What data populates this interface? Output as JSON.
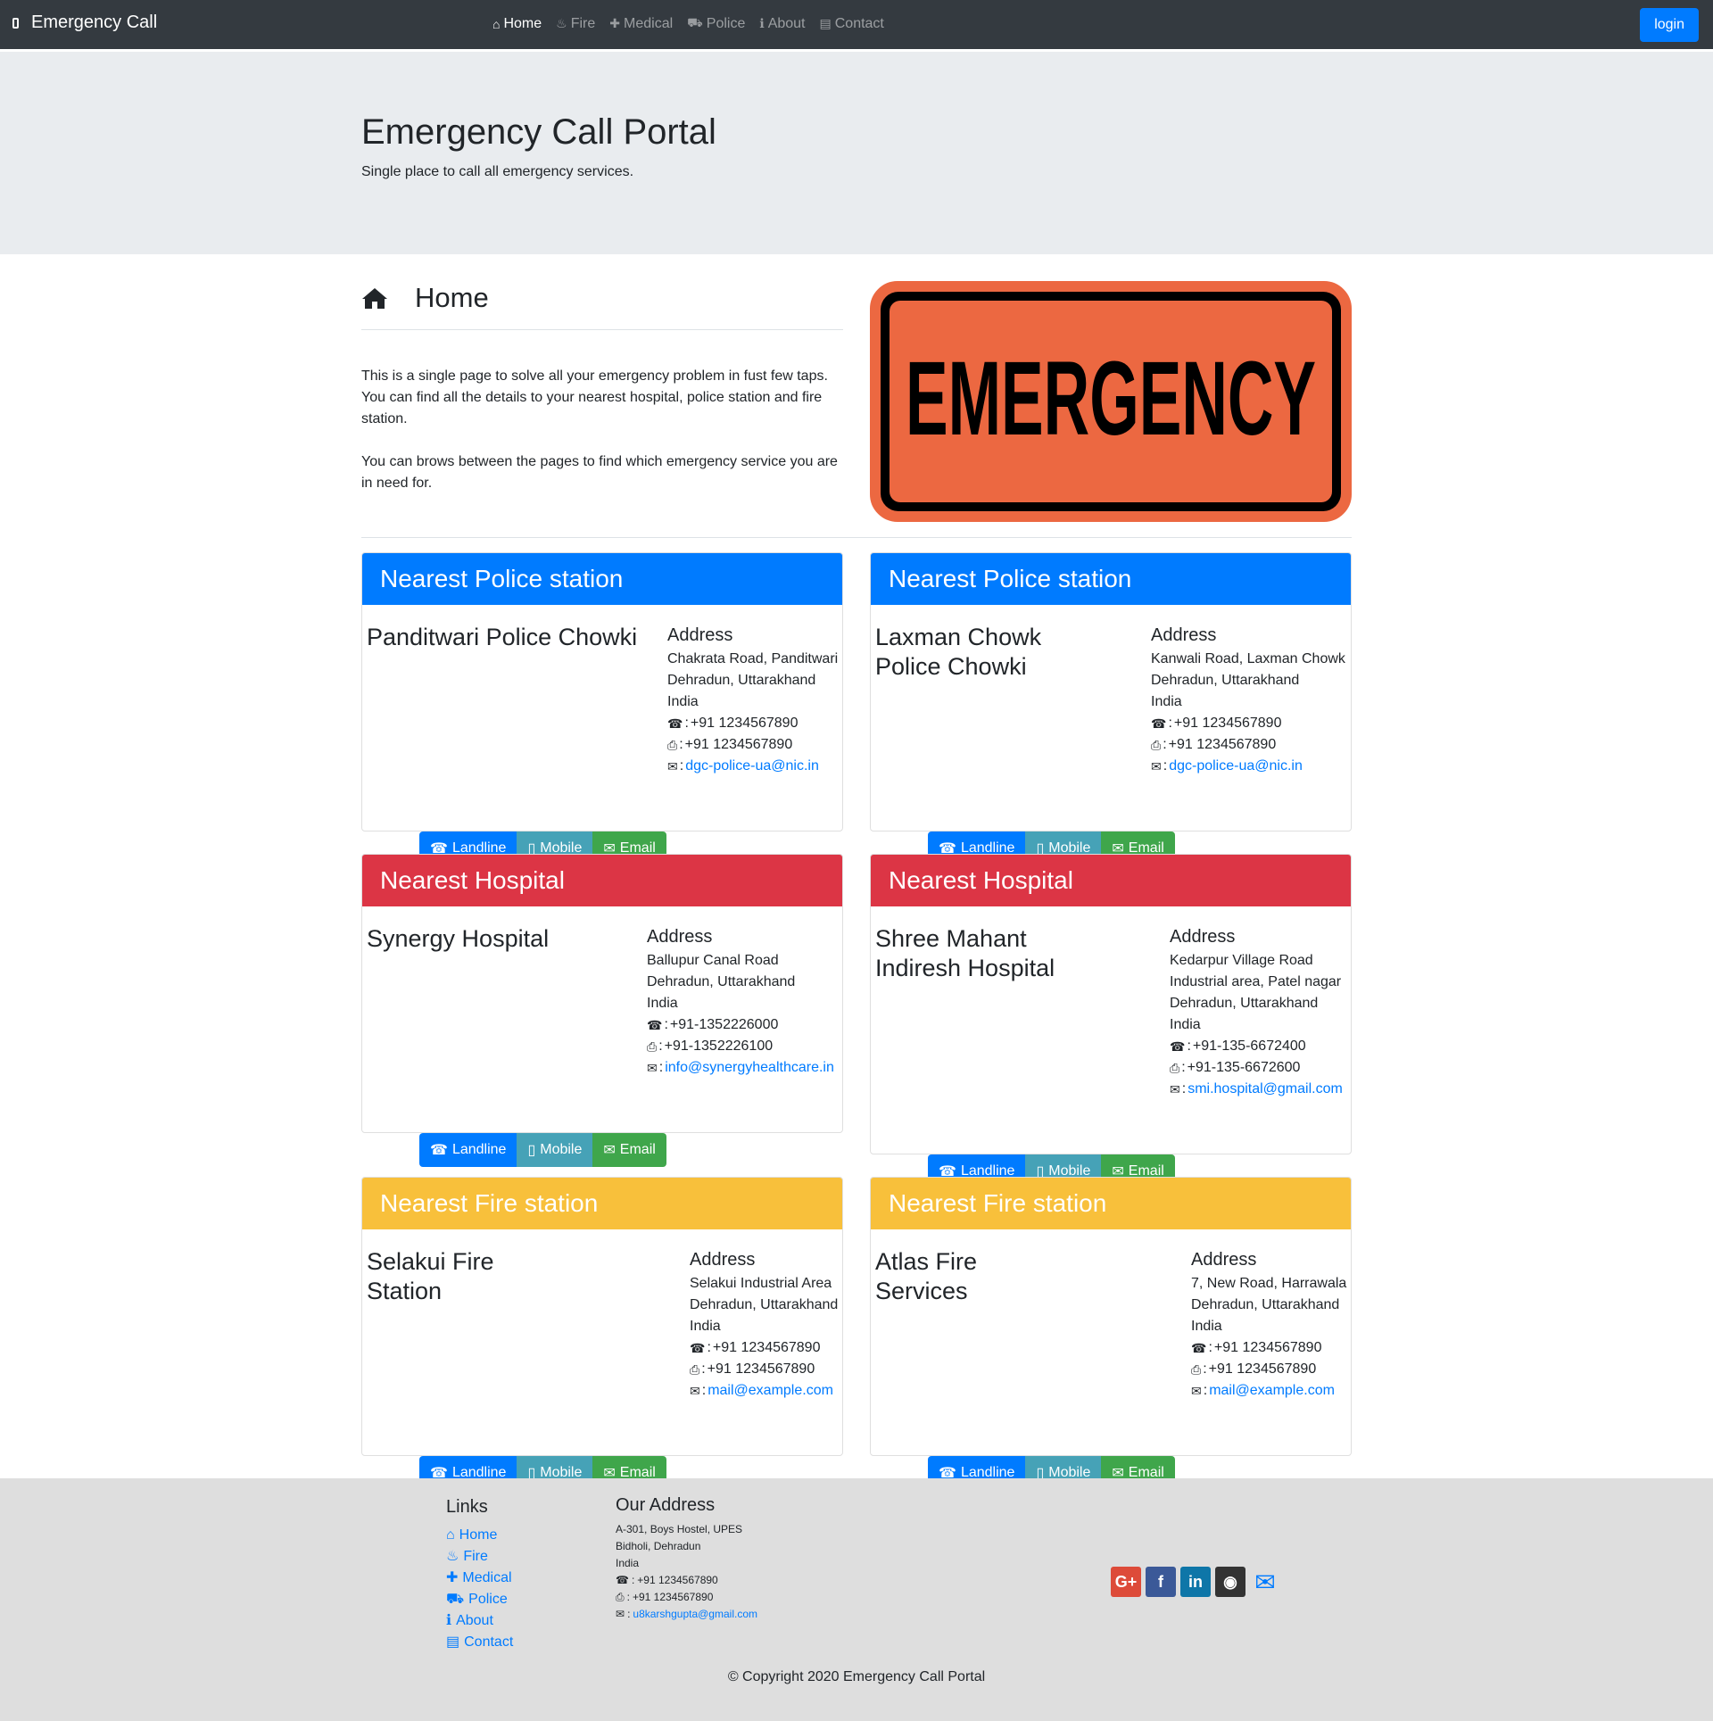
{
  "navbar": {
    "brand": "Emergency Call",
    "links": [
      {
        "icon": "home-icon",
        "label": "Home"
      },
      {
        "icon": "fire-icon",
        "label": "Fire"
      },
      {
        "icon": "ambulance-icon",
        "label": "Medical"
      },
      {
        "icon": "car-icon",
        "label": "Police"
      },
      {
        "icon": "info-icon",
        "label": "About"
      },
      {
        "icon": "address-card-icon",
        "label": "Contact"
      }
    ],
    "login": "login"
  },
  "jumbotron": {
    "title": "Emergency Call Portal",
    "subtitle": "Single place to call all emergency services."
  },
  "home": {
    "title": "Home",
    "paragraph1": "This is a single page to solve all your emergency problem in fust few taps. You can find all the details to your nearest hospital, police station and fire station.",
    "paragraph2": "You can brows between the pages to find which emergency service you are in need for.",
    "sign_text": "EMERGENCY"
  },
  "cards": [
    {
      "header": "Nearest Police station",
      "name": "Panditwari Police Chowki",
      "address_title": "Address",
      "address_lines": [
        "Chakrata Road, Panditwari",
        "Dehradun, Uttarakhand",
        "India"
      ],
      "phone": "+91 1234567890",
      "fax": "+91 1234567890",
      "email": "dgc-police-ua@nic.in"
    },
    {
      "header": "Nearest Police station",
      "name": "Laxman Chowk Police Chowki",
      "address_title": "Address",
      "address_lines": [
        "Kanwali Road, Laxman Chowk",
        "Dehradun, Uttarakhand",
        "India"
      ],
      "phone": "+91 1234567890",
      "fax": "+91 1234567890",
      "email": "dgc-police-ua@nic.in"
    },
    {
      "header": "Nearest Hospital",
      "name": "Synergy Hospital",
      "address_title": "Address",
      "address_lines": [
        "Ballupur Canal Road",
        "Dehradun, Uttarakhand",
        "India"
      ],
      "phone": "+91-1352226000",
      "fax": "+91-1352226100",
      "email": "info@synergyhealthcare.in"
    },
    {
      "header": "Nearest Hospital",
      "name": "Shree Mahant Indiresh Hospital",
      "address_title": "Address",
      "address_lines": [
        "Kedarpur Village Road",
        "Industrial area, Patel nagar",
        "Dehradun, Uttarakhand",
        "India"
      ],
      "phone": "+91-135-6672400",
      "fax": "+91-135-6672600",
      "email": "smi.hospital@gmail.com"
    },
    {
      "header": "Nearest Fire station",
      "name": "Selakui Fire Station",
      "address_title": "Address",
      "address_lines": [
        "Selakui Industrial Area",
        "Dehradun, Uttarakhand",
        "India"
      ],
      "phone": "+91 1234567890",
      "fax": "+91 1234567890",
      "email": "mail@example.com"
    },
    {
      "header": "Nearest Fire station",
      "name": "Atlas Fire Services",
      "address_title": "Address",
      "address_lines": [
        "7, New Road, Harrawala",
        "Dehradun, Uttarakhand",
        "India"
      ],
      "phone": "+91 1234567890",
      "fax": "+91 1234567890",
      "email": "mail@example.com"
    }
  ],
  "buttons": {
    "landline": "Landline",
    "mobile": "Mobile",
    "email": "Email"
  },
  "footer": {
    "links_title": "Links",
    "links": [
      "Home",
      "Fire",
      "Medical",
      "Police",
      "About",
      "Contact"
    ],
    "address_title": "Our Address",
    "address_lines": [
      "A-301, Boys Hostel, UPES",
      "Bidholi, Dehradun",
      "India"
    ],
    "phone": "+91 1234567890",
    "fax": "+91 1234567890",
    "email": "u8karshgupta@gmail.com",
    "copyright": "© Copyright 2020 Emergency Call Portal",
    "social": [
      {
        "icon": "google-plus-icon",
        "color": "#dd4b39"
      },
      {
        "icon": "facebook-icon",
        "color": "#3b5998"
      },
      {
        "icon": "linkedin-icon",
        "color": "#0e76a8"
      },
      {
        "icon": "github-icon",
        "color": "#333333"
      },
      {
        "icon": "envelope-icon",
        "color": "#007bff"
      }
    ]
  },
  "colors": {
    "police": "#007bff",
    "hospital": "#dc3545",
    "fire": "#f8c03b",
    "navbar": "#343a40"
  }
}
